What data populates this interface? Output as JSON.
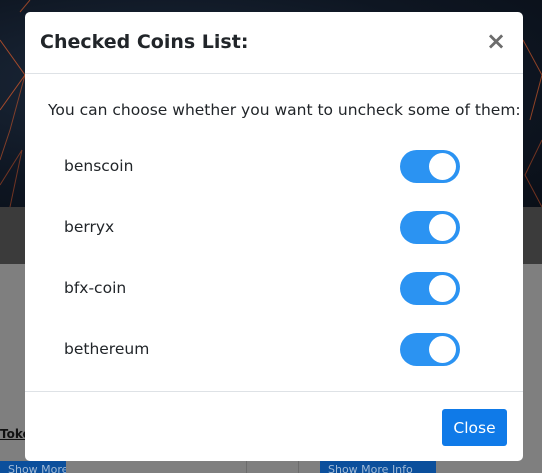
{
  "modal": {
    "title": "Checked Coins List:",
    "close_icon": "×",
    "intro": "You can choose whether you want to uncheck some of them:",
    "coins": [
      {
        "name": "benscoin",
        "checked": true
      },
      {
        "name": "berryx",
        "checked": true
      },
      {
        "name": "bfx-coin",
        "checked": true
      },
      {
        "name": "bethereum",
        "checked": true
      }
    ],
    "close_label": "Close"
  },
  "background": {
    "link_text": "Toke",
    "button_left": "Show More Info",
    "button_right": "Show More Info"
  },
  "colors": {
    "toggle_on": "#2b93f2",
    "primary_button": "#0f7ae8"
  }
}
